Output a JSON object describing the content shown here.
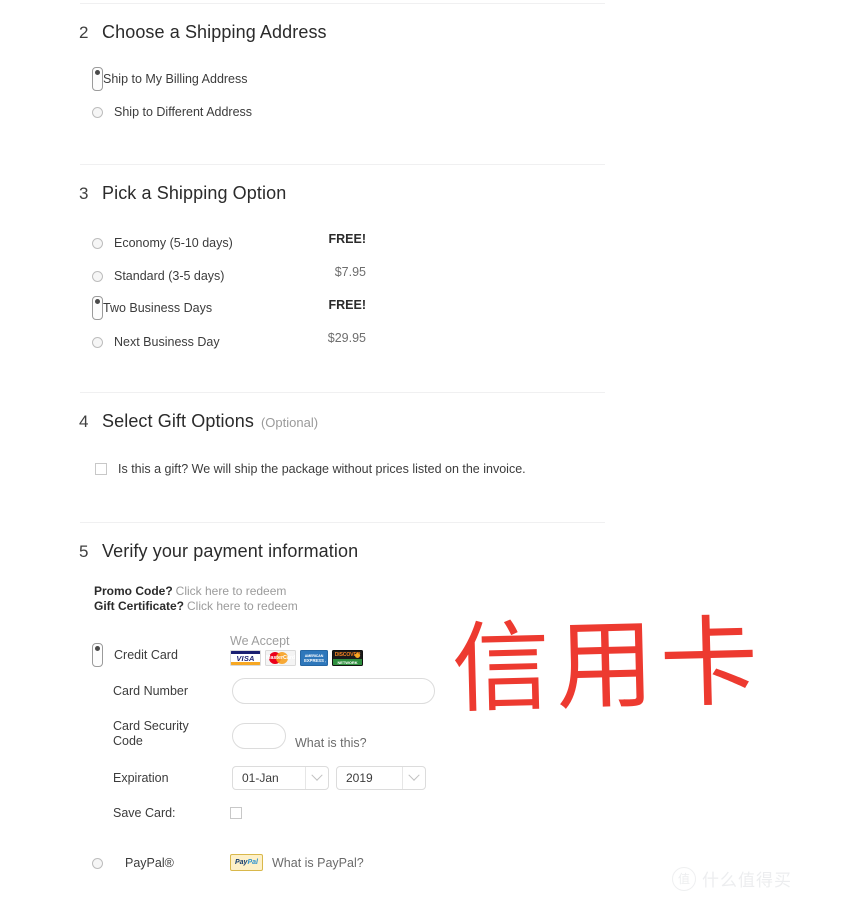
{
  "sections": {
    "shipping_address": {
      "number": "2",
      "title": "Choose a Shipping Address",
      "options": [
        {
          "label": "Ship to My Billing Address",
          "selected": true
        },
        {
          "label": "Ship to Different Address",
          "selected": false
        }
      ]
    },
    "shipping_option": {
      "number": "3",
      "title": "Pick a Shipping Option",
      "options": [
        {
          "label": "Economy (5-10 days)",
          "price": "FREE!",
          "price_style": "free",
          "selected": false
        },
        {
          "label": "Standard (3-5 days)",
          "price": "$7.95",
          "price_style": "amt",
          "selected": false
        },
        {
          "label": "Two Business Days",
          "price": "FREE!",
          "price_style": "free",
          "selected": true
        },
        {
          "label": "Next Business Day",
          "price": "$29.95",
          "price_style": "amt",
          "selected": false
        }
      ]
    },
    "gift_options": {
      "number": "4",
      "title": "Select Gift Options",
      "optional_tag": "(Optional)",
      "checkbox_label": "Is this a gift? We will ship the package without prices listed on the invoice.",
      "checked": false
    },
    "payment": {
      "number": "5",
      "title": "Verify your payment information",
      "promo": {
        "promo_label": "Promo Code?",
        "promo_link": "Click here to redeem",
        "gift_cert_label": "Gift Certificate?",
        "gift_cert_link": "Click here to redeem"
      },
      "credit_card": {
        "radio_label": "Credit Card",
        "selected": true,
        "we_accept": "We Accept",
        "accepted_cards": [
          "VISA",
          "MasterCard",
          "AMERICAN EXPRESS",
          "DISCOVER"
        ],
        "card_number_label": "Card Number",
        "card_number_value": "",
        "security_code_label": "Card Security Code",
        "security_code_value": "",
        "security_hint": "What is this?",
        "expiration_label": "Expiration",
        "expiration_month": "01-Jan",
        "expiration_year": "2019",
        "save_card_label": "Save Card:",
        "save_card_checked": false
      },
      "paypal": {
        "radio_label": "PayPal®",
        "selected": false,
        "logo_text_1": "Pay",
        "logo_text_2": "Pal",
        "hint": "What is PayPal?"
      }
    }
  },
  "annotation": {
    "text": "信用卡",
    "color": "#ed3a30"
  },
  "watermark": {
    "mark": "值",
    "text": "什么值得买"
  },
  "colors": {
    "divider": "#f0f0f1",
    "text_primary": "#2b2b2b",
    "text_secondary": "#6e6e6e",
    "muted": "#9b9b9b",
    "annotation_red": "#ed3a30"
  }
}
